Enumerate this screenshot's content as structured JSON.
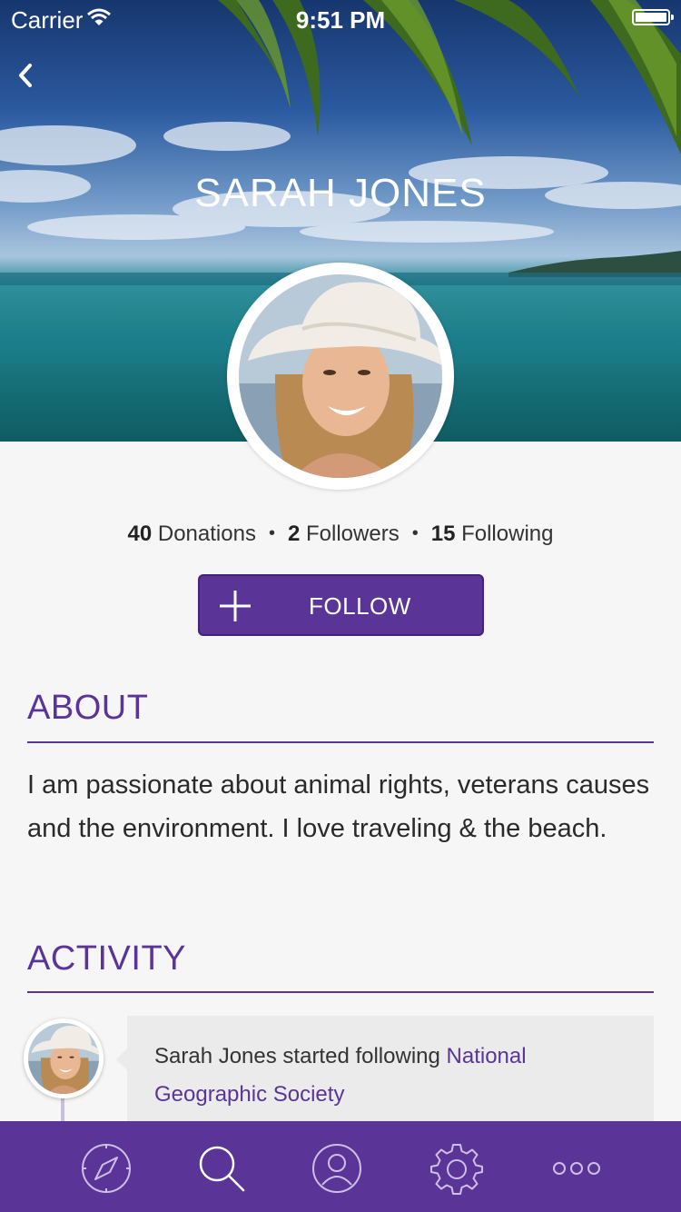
{
  "status_bar": {
    "carrier": "Carrier",
    "time": "9:51 PM"
  },
  "profile": {
    "name": "SARAH JONES",
    "stats": {
      "donations_count": "40",
      "donations_label": "Donations",
      "followers_count": "2",
      "followers_label": "Followers",
      "following_count": "15",
      "following_label": "Following",
      "separator": "•"
    },
    "follow_label": "FOLLOW"
  },
  "about": {
    "title": "ABOUT",
    "text": "I am passionate about animal rights, veterans causes and the environment. I love traveling & the beach."
  },
  "activity": {
    "title": "ACTIVITY",
    "items": [
      {
        "text": "Sarah Jones started following ",
        "link": "National Geographic Society"
      }
    ]
  },
  "tab_bar": {
    "items": [
      {
        "icon": "compass-icon"
      },
      {
        "icon": "search-icon"
      },
      {
        "icon": "profile-icon"
      },
      {
        "icon": "gear-icon"
      },
      {
        "icon": "more-icon"
      }
    ]
  },
  "colors": {
    "accent": "#5a3497",
    "background": "#f6f6f6",
    "card": "#ebebeb"
  }
}
